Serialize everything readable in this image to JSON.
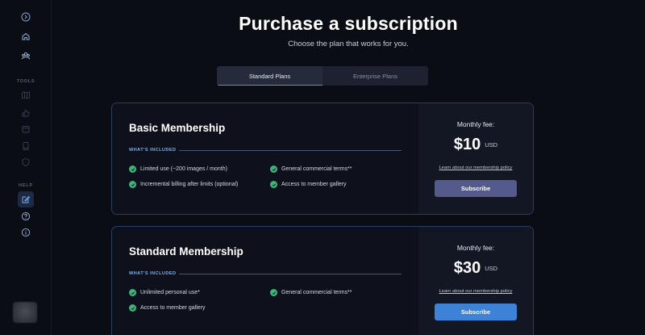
{
  "header": {
    "title": "Purchase a subscription",
    "subtitle": "Choose the plan that works for you."
  },
  "tabs": [
    {
      "label": "Standard Plans",
      "active": true
    },
    {
      "label": "Enterprise Plans",
      "active": false
    }
  ],
  "sidebar": {
    "tools_label": "TOOLS",
    "help_label": "HELP",
    "icons": [
      "expand-icon",
      "home-icon",
      "community-icon",
      "map-icon",
      "thumbs-up-icon",
      "calendar-icon",
      "tablet-icon",
      "shield-icon",
      "edit-icon",
      "help-icon",
      "info-icon"
    ]
  },
  "plans": [
    {
      "name": "Basic Membership",
      "included_label": "WHAT'S INCLUDED",
      "features": [
        "Limited use (~200 images / month)",
        "General commercial terms**",
        "Incremental billing after limits (optional)",
        "Access to member gallery"
      ],
      "fee_label": "Monthly fee:",
      "price": "$10",
      "currency": "USD",
      "policy_link": "Learn about our membership policy",
      "button": "Subscribe",
      "button_color": "#545a8c"
    },
    {
      "name": "Standard Membership",
      "included_label": "WHAT'S INCLUDED",
      "features": [
        "Unlimited personal use*",
        "General commercial terms**",
        "Access to member gallery"
      ],
      "fee_label": "Monthly fee:",
      "price": "$30",
      "currency": "USD",
      "policy_link": "Learn about our membership policy",
      "button": "Subscribe",
      "button_color": "#3d82d6"
    }
  ],
  "colors": {
    "background": "#0b0d14",
    "accent": "#4b93e6",
    "check": "#3cb57a",
    "card_border": "#2b3d63"
  }
}
